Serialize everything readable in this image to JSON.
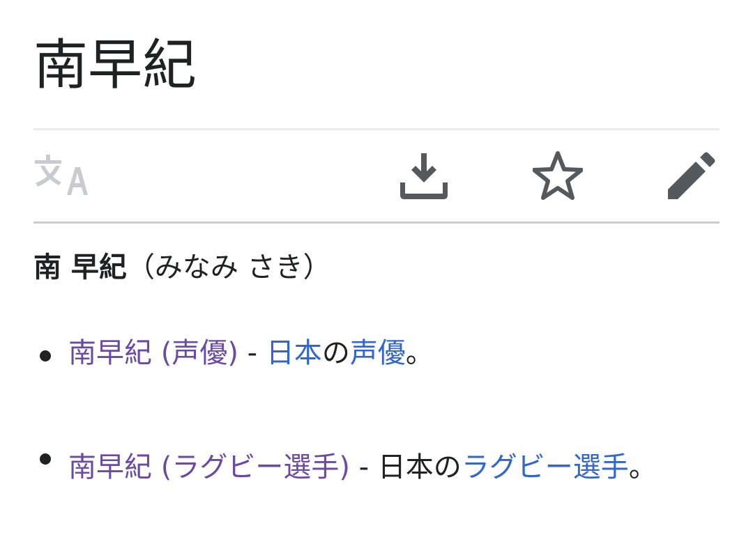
{
  "page": {
    "title": "南早紀"
  },
  "toolbar": {
    "language_icon": "translate-icon",
    "download_icon": "download-icon",
    "watch_icon": "star-icon",
    "edit_icon": "pencil-icon",
    "colors": {
      "icon_active": "#54595d",
      "icon_disabled": "#c8ccd1"
    }
  },
  "lead": {
    "bold": "南 早紀",
    "reading": "（みなみ さき）"
  },
  "list": {
    "items": [
      {
        "link_text": "南早紀 (声優)",
        "separator": " - ",
        "desc_link1": "日本",
        "desc_mid": "の",
        "desc_link2": "声優",
        "desc_end": "。"
      },
      {
        "link_text": "南早紀 (ラグビー選手)",
        "separator": " - ",
        "desc_plain": "日本の",
        "desc_link": "ラグビー選手",
        "desc_end": "。"
      }
    ]
  },
  "colors": {
    "text": "#202122",
    "link": "#3366cc",
    "visited_link": "#6b4ba1"
  }
}
